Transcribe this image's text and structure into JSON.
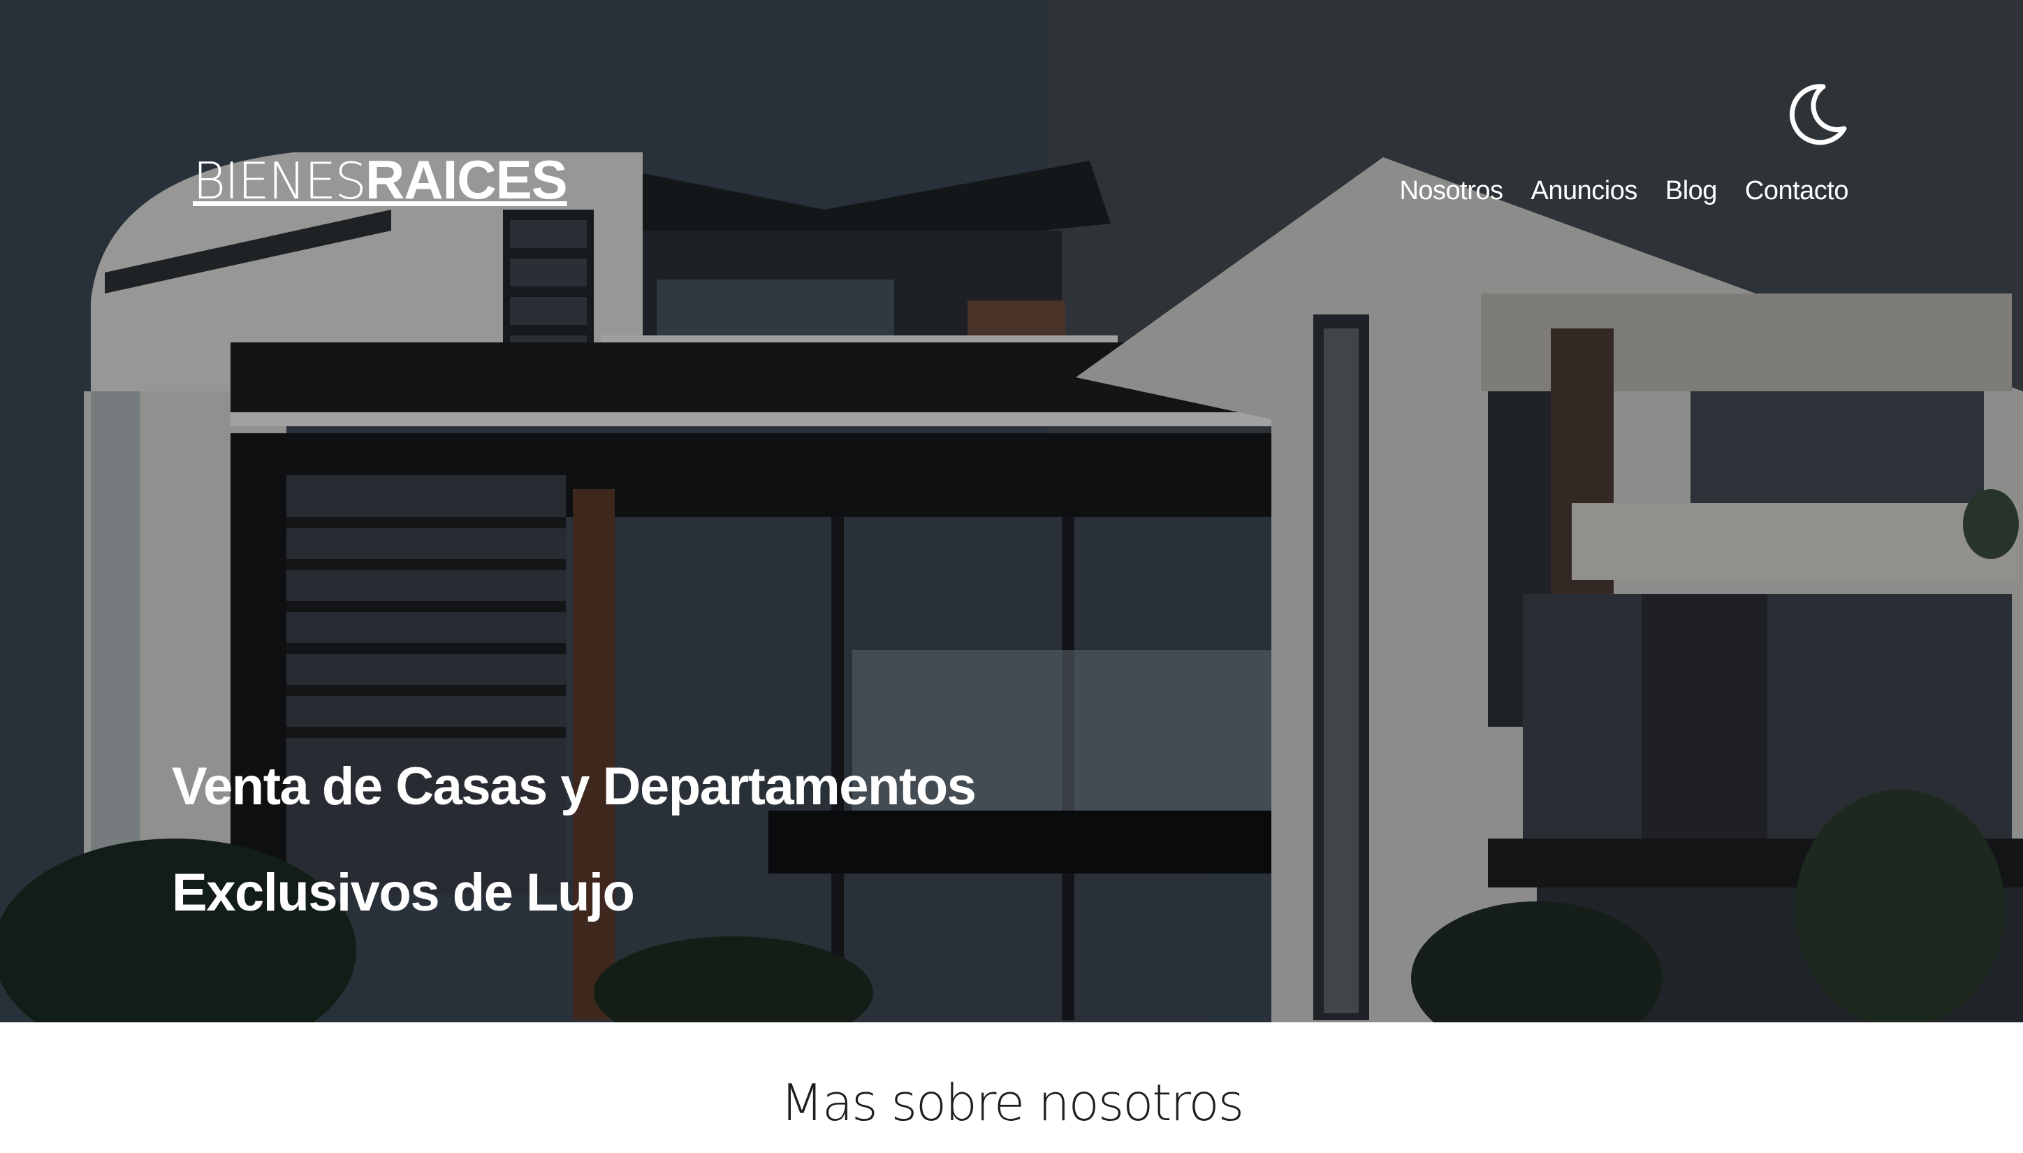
{
  "header": {
    "logo_light": "BIENES",
    "logo_bold": "RAICES",
    "theme_icon": "moon-icon",
    "nav": [
      {
        "label": "Nosotros"
      },
      {
        "label": "Anuncios"
      },
      {
        "label": "Blog"
      },
      {
        "label": "Contacto"
      }
    ]
  },
  "hero": {
    "headline_line1": "Venta de Casas y Departamentos",
    "headline_line2": "Exclusivos de Lujo"
  },
  "about": {
    "title": "Mas sobre nosotros"
  },
  "colors": {
    "text_on_hero": "#ffffff",
    "section_title": "#1e1e1e"
  }
}
